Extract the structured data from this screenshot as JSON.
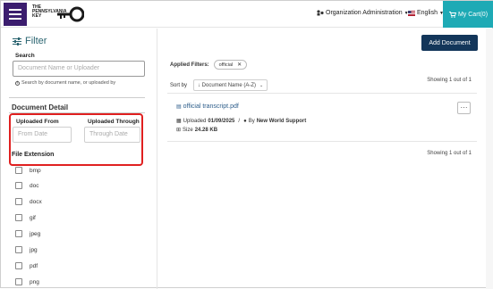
{
  "header": {
    "logo_text": "THE PENNSYLVANIA KEY",
    "org_admin": "Organization Administration",
    "language": "English",
    "cart": "My Cart(0)"
  },
  "sidebar": {
    "title": "Filter",
    "search_label": "Search",
    "search_placeholder": "Document Name or Uploader",
    "search_hint": "Search by document name, or uploaded by",
    "document_detail": "Document Detail",
    "uploaded_from_label": "Uploaded From",
    "uploaded_from_placeholder": "From Date",
    "uploaded_through_label": "Uploaded Through",
    "uploaded_through_placeholder": "Through Date",
    "file_extension": "File Extension",
    "extensions": [
      "bmp",
      "doc",
      "docx",
      "gif",
      "jpeg",
      "jpg",
      "pdf",
      "png"
    ]
  },
  "main": {
    "add_document": "Add Document",
    "applied_filters_label": "Applied Filters:",
    "chip_label": "official",
    "sort_label": "Sort by",
    "sort_value": "↓ Document Name (A-Z)",
    "showing_top": "Showing 1 out of 1",
    "showing_bottom": "Showing 1 out of 1",
    "document": {
      "name": "official transcript.pdf",
      "uploaded_prefix": "Uploaded",
      "uploaded_date": "01/09/2025",
      "by_prefix": "By",
      "uploader": "New World Support",
      "size_prefix": "Size",
      "size": "24.28 KB"
    }
  },
  "colors": {
    "menu_bg": "#3b1d6e",
    "cart_bg": "#1eaab5",
    "add_btn_bg": "#13365a",
    "highlight": "#e02020",
    "filter_title": "#2a6470",
    "link": "#2d5d8a"
  },
  "icons": [
    "hamburger-icon",
    "key-icon",
    "org-admin-icon",
    "flag-icon",
    "cart-icon",
    "filter-icon",
    "info-icon",
    "x-icon",
    "file-icon",
    "calendar-icon",
    "user-icon",
    "size-icon",
    "chevron-down-icon"
  ]
}
